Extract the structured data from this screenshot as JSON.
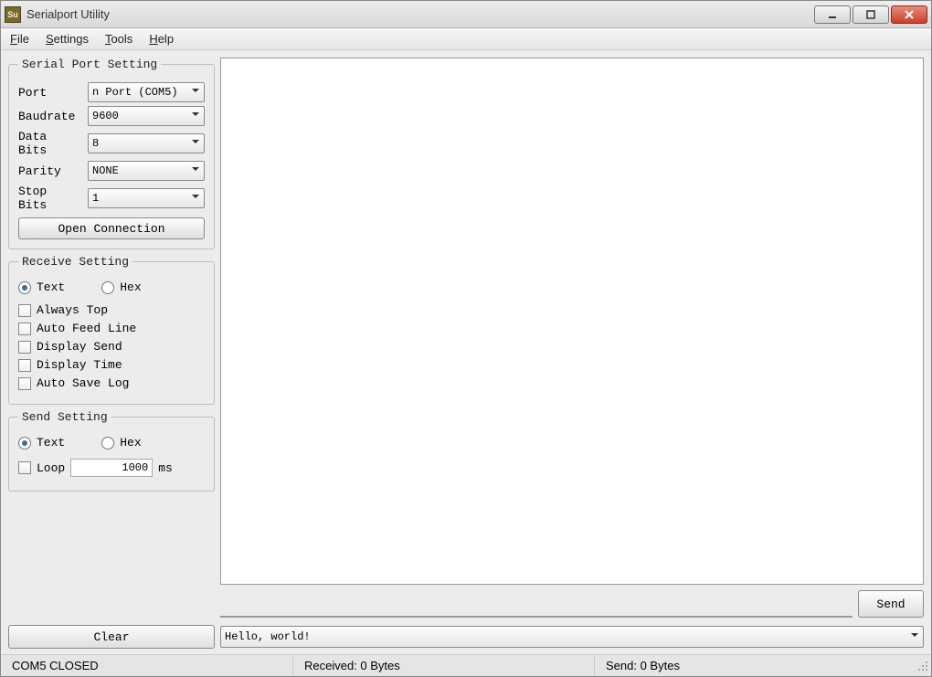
{
  "window": {
    "title": "Serialport Utility",
    "app_icon_text": "Su"
  },
  "menubar": {
    "file": "File",
    "settings": "Settings",
    "tools": "Tools",
    "help": "Help"
  },
  "serial_port_setting": {
    "legend": "Serial Port Setting",
    "port_label": "Port",
    "port_value": "n Port (COM5)",
    "baud_label": "Baudrate",
    "baud_value": "9600",
    "databits_label": "Data Bits",
    "databits_value": "8",
    "parity_label": "Parity",
    "parity_value": "NONE",
    "stopbits_label": "Stop Bits",
    "stopbits_value": "1",
    "open_btn": "Open Connection"
  },
  "receive_setting": {
    "legend": "Receive Setting",
    "text_label": "Text",
    "hex_label": "Hex",
    "always_top": "Always Top",
    "auto_feed": "Auto Feed Line",
    "display_send": "Display Send",
    "display_time": "Display Time",
    "auto_save": "Auto Save Log"
  },
  "send_setting": {
    "legend": "Send Setting",
    "text_label": "Text",
    "hex_label": "Hex",
    "loop_label": "Loop",
    "loop_value": "1000",
    "loop_unit": "ms"
  },
  "buttons": {
    "send": "Send",
    "clear": "Clear"
  },
  "history": {
    "value": "Hello, world!"
  },
  "statusbar": {
    "port_status": "COM5 CLOSED",
    "received": "Received: 0 Bytes",
    "sent": "Send: 0 Bytes"
  }
}
